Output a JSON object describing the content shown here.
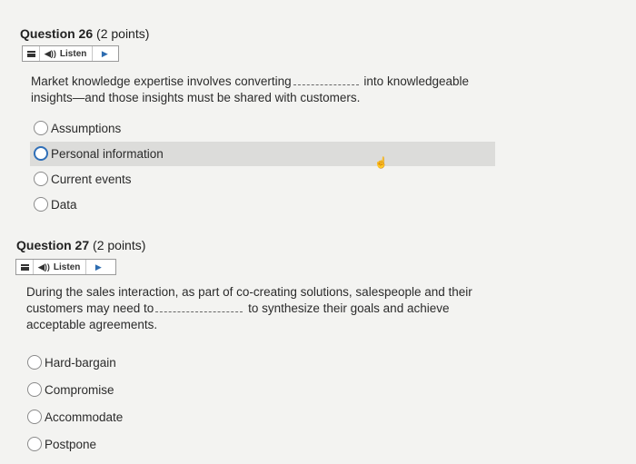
{
  "q26": {
    "title": "Question 26",
    "points": "(2 points)",
    "listen_label": "Listen",
    "text_before": "Market knowledge expertise involves converting",
    "text_after": "into knowledgeable",
    "text_line2": "insights—and those insights must be shared with customers.",
    "options": [
      "Assumptions",
      "Personal information",
      "Current events",
      "Data"
    ]
  },
  "q27": {
    "title": "Question 27",
    "points": "(2 points)",
    "listen_label": "Listen",
    "line1": "During the sales interaction, as part of co-creating solutions, salespeople and their",
    "line2_before": "customers may need to",
    "line2_after": "to synthesize their goals and achieve",
    "line3": "acceptable agreements.",
    "options": [
      "Hard-bargain",
      "Compromise",
      "Accommodate",
      "Postpone"
    ]
  },
  "icons": {
    "menu": "menu-icon",
    "speaker": "speaker-icon",
    "play": "play-icon",
    "cursor": "hand-cursor-icon"
  },
  "colors": {
    "accent": "#2f6fb8",
    "highlight": "#dcdcda",
    "background": "#f3f3f1"
  }
}
